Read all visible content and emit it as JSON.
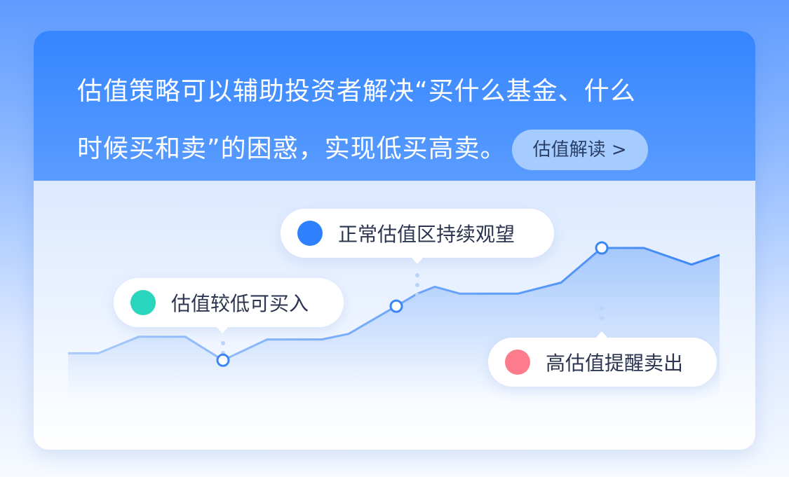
{
  "headline": {
    "line1": "估值策略可以辅助投资者解决“买什么基金、什么",
    "line2": "时候买和卖”的困惑，实现低买高卖。",
    "button_label": "估值解读 >"
  },
  "bubbles": {
    "low": {
      "label": "估值较低可买入",
      "color": "#2ad6be"
    },
    "mid": {
      "label": "正常估值区持续观望",
      "color": "#2f80fe"
    },
    "high": {
      "label": "高估值提醒卖出",
      "color": "#fd7b8a"
    }
  },
  "chart_data": {
    "type": "area",
    "series": [
      {
        "values": [
          0.22,
          0.22,
          0.34,
          0.34,
          0.17,
          0.32,
          0.32,
          0.36,
          0.56,
          0.65,
          0.7,
          0.65,
          0.65,
          0.73,
          0.98,
          0.98,
          0.86,
          0.93
        ]
      }
    ],
    "marked_points": [
      {
        "index": 4,
        "label": "low"
      },
      {
        "index": 8,
        "label": "mid"
      },
      {
        "index": 14,
        "label": "high"
      }
    ],
    "colors": {
      "line_start": "#a9cbfb",
      "line_end": "#3a86f5",
      "fill": "#5f9df7"
    }
  }
}
